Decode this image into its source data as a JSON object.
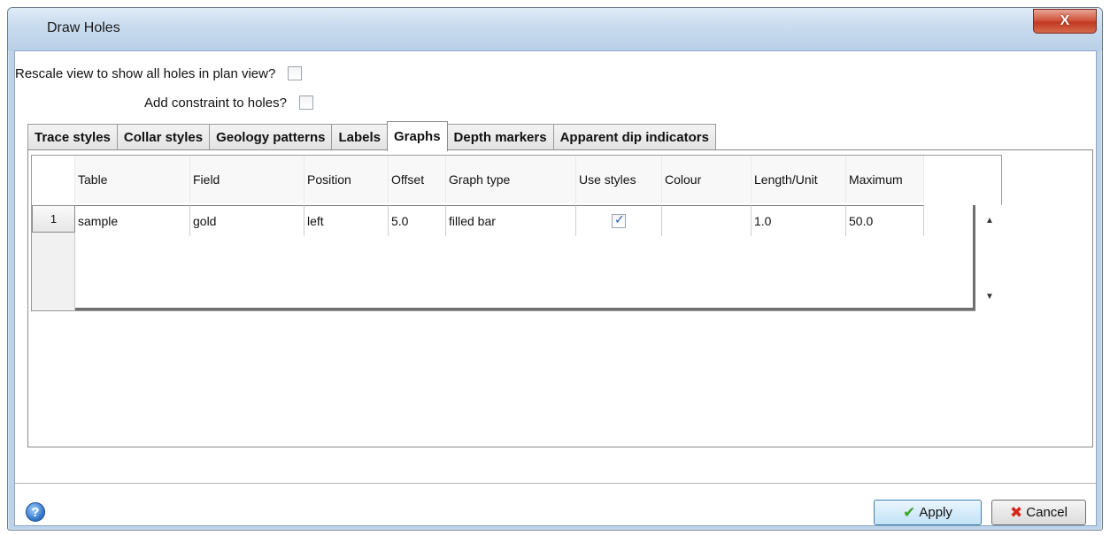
{
  "window": {
    "title": "Draw Holes",
    "close_glyph": "X"
  },
  "options": {
    "rescale_label": "Rescale view to show all holes in plan view?",
    "rescale_checked": false,
    "constraint_label": "Add constraint to holes?",
    "constraint_checked": false
  },
  "tabs": [
    {
      "label": "Trace styles",
      "active": false
    },
    {
      "label": "Collar styles",
      "active": false
    },
    {
      "label": "Geology patterns",
      "active": false
    },
    {
      "label": "Labels",
      "active": false
    },
    {
      "label": "Graphs",
      "active": true
    },
    {
      "label": "Depth markers",
      "active": false
    },
    {
      "label": "Apparent dip indicators",
      "active": false
    }
  ],
  "graphs_table": {
    "columns": [
      "Table",
      "Field",
      "Position",
      "Offset",
      "Graph type",
      "Use styles",
      "Colour",
      "Length/Unit",
      "Maximum"
    ],
    "rows": [
      {
        "index": "1",
        "table": "sample",
        "field": "gold",
        "position": "left",
        "offset": "5.0",
        "graph_type": "filled bar",
        "use_styles": true,
        "colour": "",
        "length_unit": "1.0",
        "maximum": "50.0"
      }
    ],
    "scroll_up_glyph": "▲",
    "scroll_down_glyph": "▼"
  },
  "footer": {
    "help_icon": "question-mark-icon",
    "help_glyph": "?",
    "apply_label": "Apply",
    "apply_icon": "green-check-icon",
    "apply_icon_glyph": "✔",
    "cancel_label": "Cancel",
    "cancel_icon": "red-x-icon",
    "cancel_icon_glyph": "✖"
  },
  "colors": {
    "titlebar": "#c9dbee",
    "close_button": "#c13a21",
    "apply_check": "#3aa52a",
    "cancel_x": "#d8261c",
    "help_blue": "#2d6fc4"
  }
}
